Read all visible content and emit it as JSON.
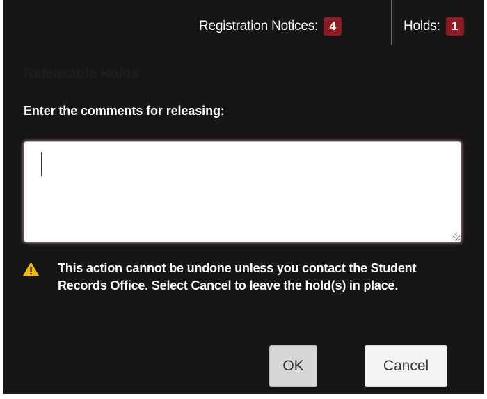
{
  "header": {
    "registration_notices_label": "Registration Notices:",
    "registration_notices_count": "4",
    "holds_label": "Holds:",
    "holds_count": "1",
    "badge_color": "#8e1b24"
  },
  "dialog": {
    "title": "Releasable Holds",
    "prompt": "Enter the comments for releasing:",
    "comments_value": "",
    "warning_icon": "warning-triangle-icon",
    "warning_text": "This action cannot be undone unless you contact the Student Records Office. Select Cancel to leave the hold(s) in place.",
    "ok_label": "OK",
    "cancel_label": "Cancel"
  },
  "colors": {
    "background": "#161616",
    "warning": "#f5b800",
    "text": "#ffffff"
  }
}
